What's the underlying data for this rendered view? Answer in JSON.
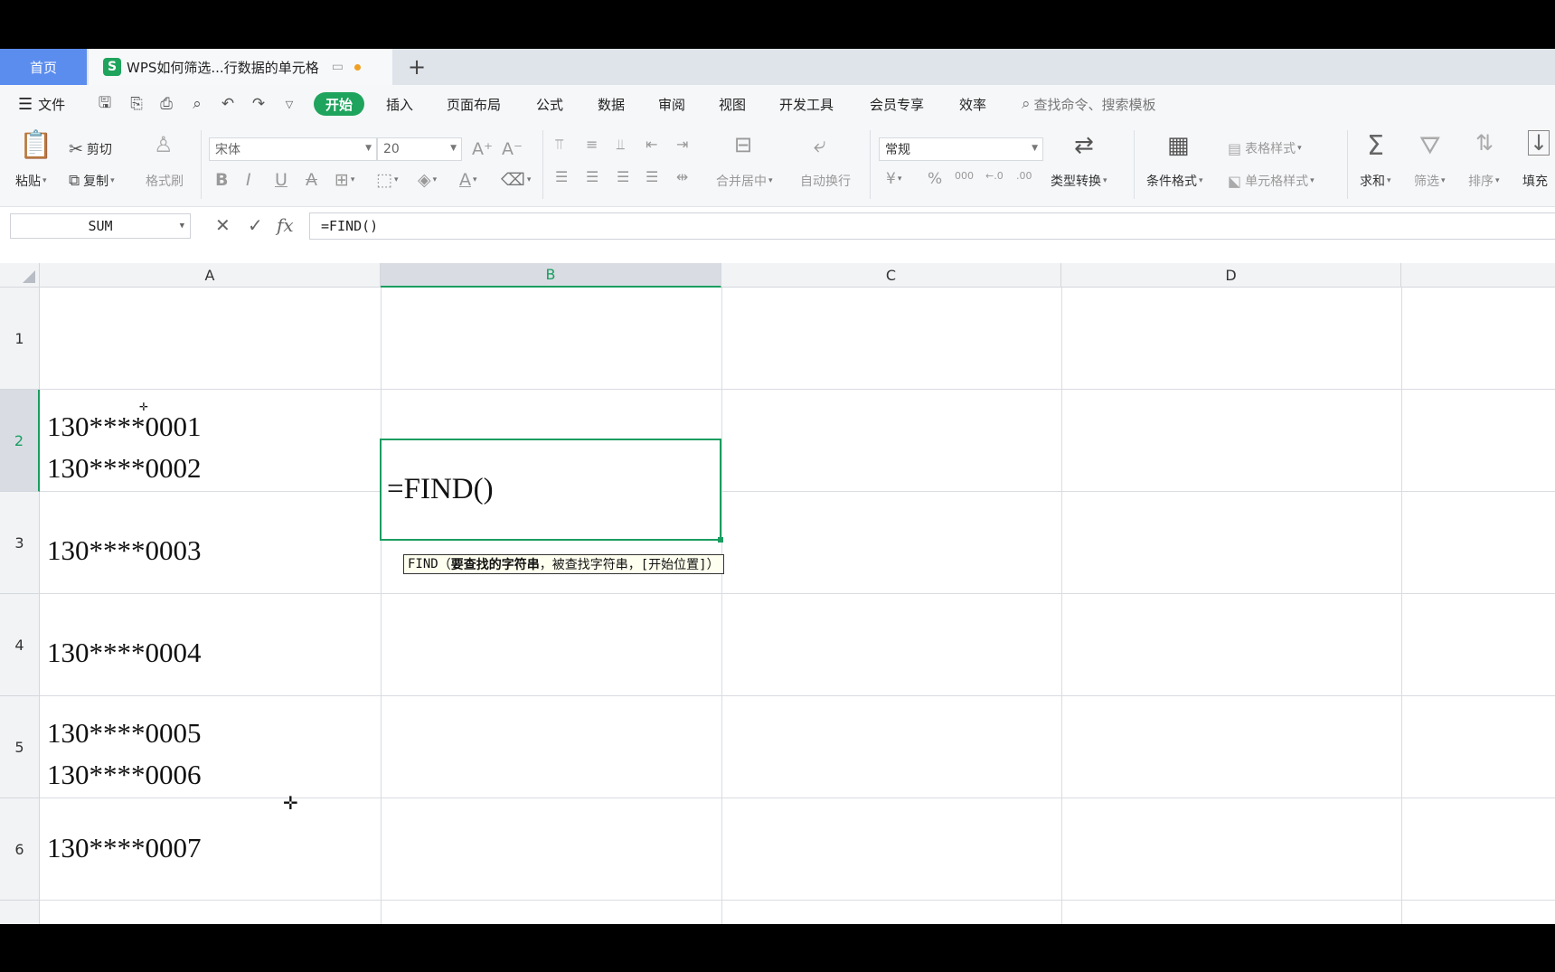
{
  "tabs": {
    "home": "首页",
    "doc_logo": "S",
    "doc_title": "WPS如何筛选...行数据的单元格",
    "add": "+"
  },
  "menu": {
    "file": "文件",
    "items": [
      "开始",
      "插入",
      "页面布局",
      "公式",
      "数据",
      "审阅",
      "视图",
      "开发工具",
      "会员专享",
      "效率"
    ],
    "search": "查找命令、搜索模板"
  },
  "ribbon": {
    "paste": "粘贴",
    "cut": "剪切",
    "copy": "复制",
    "format_painter": "格式刷",
    "font_name": "宋体",
    "font_size": "20",
    "merge_center": "合并居中",
    "wrap_text": "自动换行",
    "number_format": "常规",
    "type_convert": "类型转换",
    "cond_format": "条件格式",
    "table_style": "表格样式",
    "cell_style": "单元格样式",
    "sum": "求和",
    "filter": "筛选",
    "sort": "排序",
    "fill": "填充",
    "currency_symbol": "¥",
    "percent_symbol": "%",
    "thousands_symbol": "000"
  },
  "formula_bar": {
    "name_box": "SUM",
    "fx": "fx",
    "formula": "=FIND()"
  },
  "grid": {
    "columns": [
      "A",
      "B",
      "C",
      "D"
    ],
    "rows": [
      "1",
      "2",
      "3",
      "4",
      "5",
      "6"
    ],
    "cells_a": {
      "r2_line1": "130****0001",
      "r2_line2": "130****0002",
      "r3": "130****0003",
      "r4": "130****0004",
      "r5_line1": "130****0005",
      "r5_line2": "130****0006",
      "r6": "130****0007"
    },
    "active_cell_value": "=FIND()",
    "tooltip": {
      "func": "FIND",
      "open": "（",
      "arg1": "要查找的字符串",
      "rest": "，被查找字符串，[开始位置]）"
    }
  },
  "colors": {
    "accent": "#1fa45d",
    "home_tab": "#5b8def",
    "selection": "#1a9d60"
  }
}
